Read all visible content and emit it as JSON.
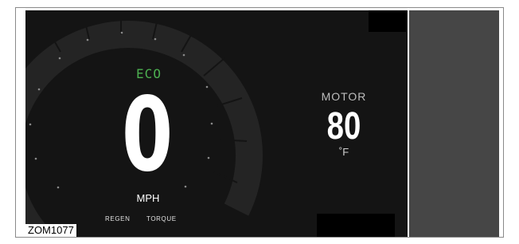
{
  "dashboard": {
    "mode": "ECO",
    "speed": "0",
    "speed_unit": "MPH",
    "regen_label": "REGEN",
    "torque_label": "TORQUE",
    "motor": {
      "label": "MOTOR",
      "value": "80",
      "unit": "˚F"
    }
  },
  "caption": "ZOM1077",
  "colors": {
    "screen_bg": "#141414",
    "mode_accent": "#4caf50",
    "side_panel": "#464646"
  }
}
